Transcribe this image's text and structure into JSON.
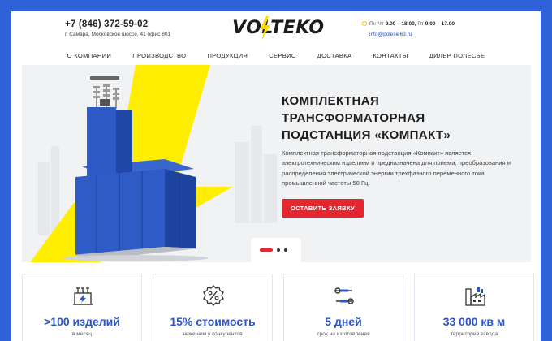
{
  "header": {
    "phone": "+7 (846) 372-59-02",
    "address": "г. Самара, Московское шоссе, 41 офис 801",
    "logo_text": "VOLTEKO",
    "hours_days1": "Пн-Чт",
    "hours_time1": "9.00 – 18.00,",
    "hours_days2": "Пт",
    "hours_time2": "9.00 – 17.00",
    "email": "info@polesie63.ru",
    "hours_icon": "clock-icon"
  },
  "nav": [
    {
      "label": "О КОМПАНИИ"
    },
    {
      "label": "ПРОИЗВОДСТВО"
    },
    {
      "label": "ПРОДУКЦИЯ"
    },
    {
      "label": "СЕРВИС"
    },
    {
      "label": "ДОСТАВКА"
    },
    {
      "label": "КОНТАКТЫ"
    },
    {
      "label": "ДИЛЕР ПОЛЕСЬЕ"
    }
  ],
  "hero": {
    "title_line1": "КОМПЛЕКТНАЯ",
    "title_line2": "ТРАНСФОРМАТОРНАЯ",
    "title_line3": "ПОДСТАНЦИЯ «КОМПАКТ»",
    "description": "Комплектная трансформаторная подстанция «Компакт» является электротехническим изделием и предназначена для приема, преобразования и распределения электрической энергии трехфазного переменного тока промышленной частоты 50 Гц.",
    "cta_label": "ОСТАВИТЬ ЗАЯВКУ",
    "slides_total": 3,
    "active_slide": 1
  },
  "stats": [
    {
      "icon": "transformer-icon",
      "value": ">100 изделий",
      "label": "в месяц"
    },
    {
      "icon": "percent-icon",
      "value": "15% стоимость",
      "label": "ниже чем у конкурентов"
    },
    {
      "icon": "tools-icon",
      "value": "5 дней",
      "label": "срок на изготовления"
    },
    {
      "icon": "factory-icon",
      "value": "33 000 кв м",
      "label": "территория завода"
    }
  ],
  "colors": {
    "background": "#2f62d8",
    "accent_blue": "#2b55c8",
    "accent_red": "#e5262f",
    "accent_yellow": "#ffee00"
  }
}
